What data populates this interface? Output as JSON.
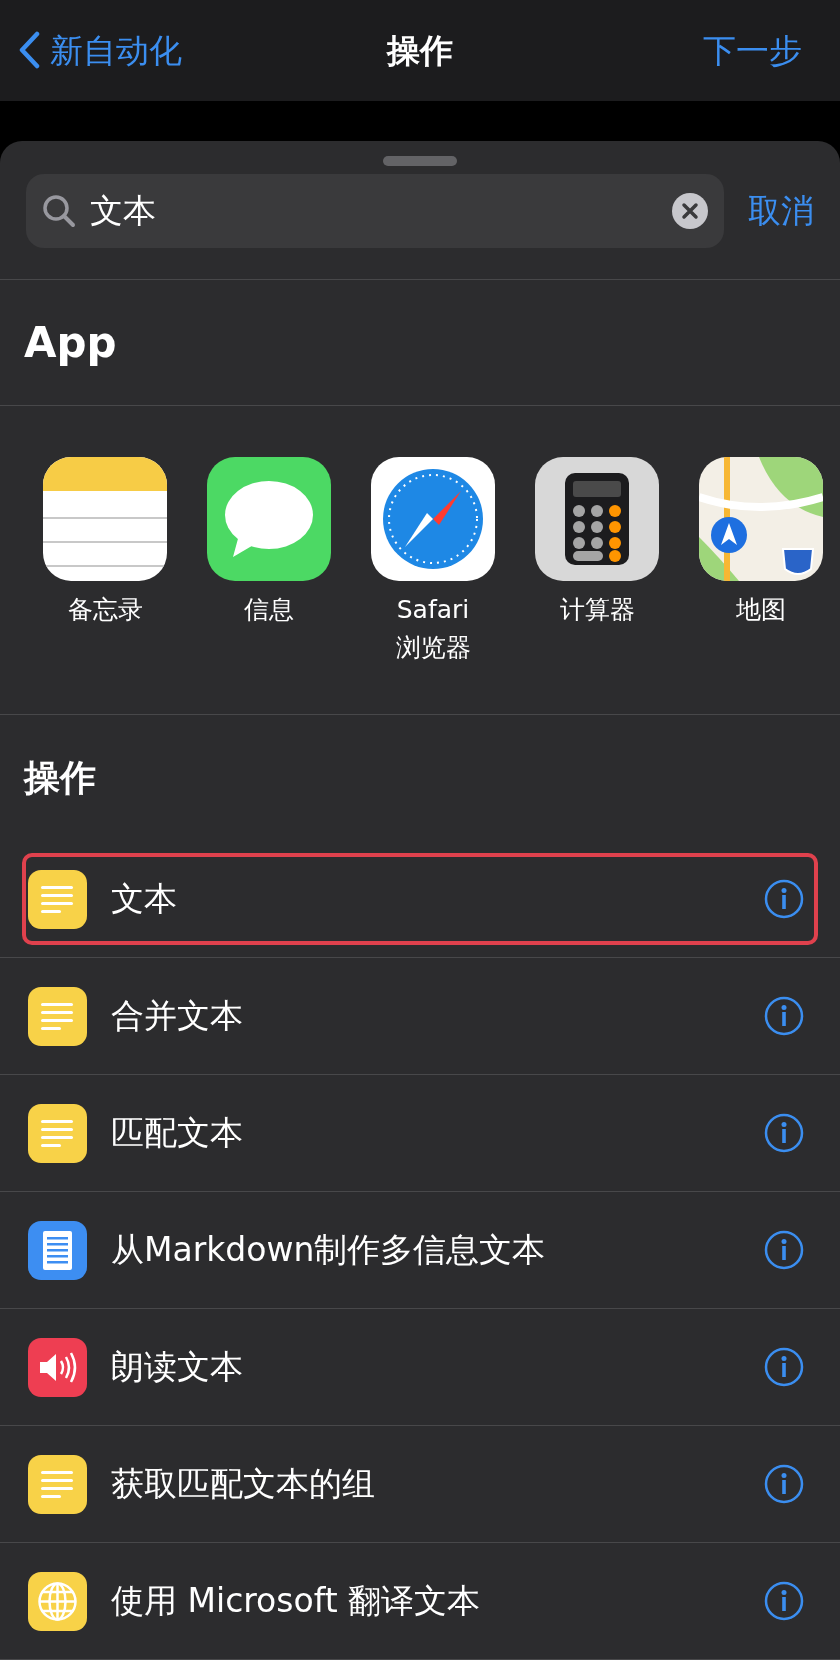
{
  "nav": {
    "back": "新自动化",
    "title": "操作",
    "next": "下一步"
  },
  "search": {
    "value": "文本",
    "cancel": "取消"
  },
  "apps_header": "App",
  "apps": [
    {
      "kind": "notes",
      "lines": [
        "备忘录"
      ]
    },
    {
      "kind": "messages",
      "lines": [
        "信息"
      ]
    },
    {
      "kind": "safari",
      "lines": [
        "Safari",
        "浏览器"
      ]
    },
    {
      "kind": "calculator",
      "lines": [
        "计算器"
      ]
    },
    {
      "kind": "maps",
      "lines": [
        "地图"
      ]
    }
  ],
  "actions_header": "操作",
  "actions": [
    {
      "kind": "text",
      "label": "文本",
      "highlighted": true
    },
    {
      "kind": "text",
      "label": "合并文本",
      "highlighted": false
    },
    {
      "kind": "text",
      "label": "匹配文本",
      "highlighted": false
    },
    {
      "kind": "document",
      "label": "从Markdown制作多信息文本",
      "highlighted": false
    },
    {
      "kind": "speaker",
      "label": "朗读文本",
      "highlighted": false
    },
    {
      "kind": "text",
      "label": "获取匹配文本的组",
      "highlighted": false
    },
    {
      "kind": "globe",
      "label": "使用 Microsoft 翻译文本",
      "highlighted": false
    }
  ]
}
